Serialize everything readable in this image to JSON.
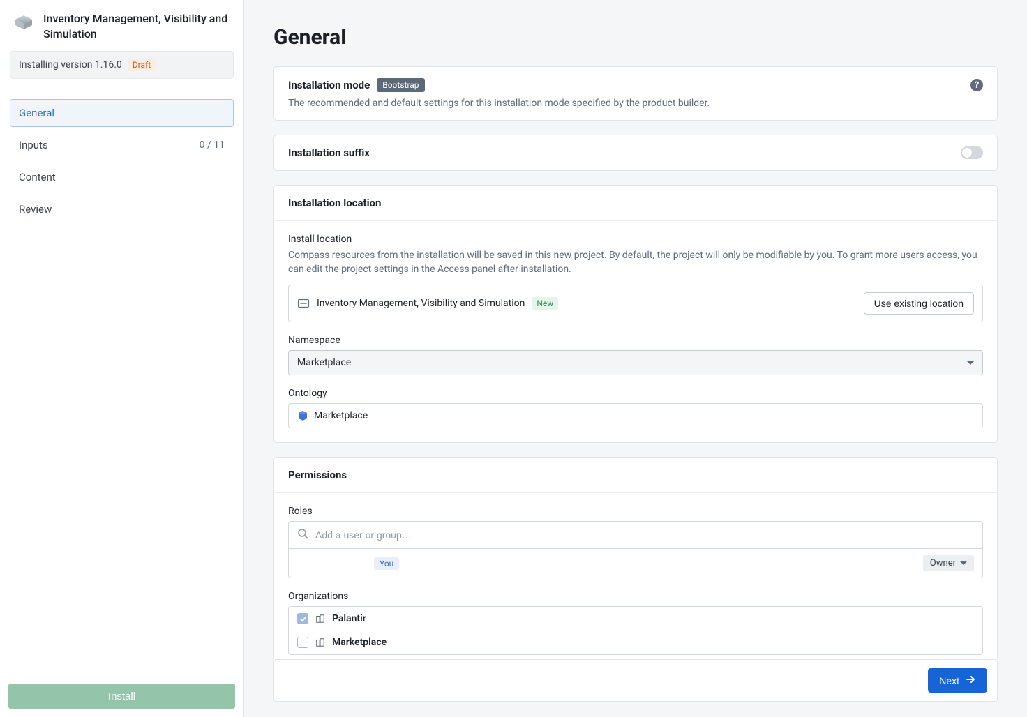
{
  "sidebar": {
    "product_title": "Inventory Management, Visibility and Simulation",
    "version_text": "Installing version 1.16.0",
    "draft_label": "Draft",
    "nav": {
      "general": "General",
      "inputs": "Inputs",
      "inputs_count": "0 / 11",
      "content": "Content",
      "review": "Review"
    },
    "install_button": "Install"
  },
  "page": {
    "title": "General"
  },
  "install_mode": {
    "title": "Installation mode",
    "badge": "Bootstrap",
    "description": "The recommended and default settings for this installation mode specified by the product builder."
  },
  "install_suffix": {
    "title": "Installation suffix"
  },
  "install_location": {
    "title": "Installation location",
    "install_loc_label": "Install location",
    "install_loc_help": "Compass resources from the installation will be saved in this new project. By default, the project will only be modifiable by you. To grant more users access, you can edit the project settings in the Access panel after installation.",
    "project_name": "Inventory Management, Visibility and Simulation",
    "new_badge": "New",
    "use_existing_button": "Use existing location",
    "namespace_label": "Namespace",
    "namespace_value": "Marketplace",
    "ontology_label": "Ontology",
    "ontology_value": "Marketplace"
  },
  "permissions": {
    "title": "Permissions",
    "roles_label": "Roles",
    "search_placeholder": "Add a user or group…",
    "you_label": "You",
    "owner_label": "Owner",
    "orgs_label": "Organizations",
    "orgs": [
      {
        "name": "Palantir",
        "checked": true
      },
      {
        "name": "Marketplace",
        "checked": false
      }
    ]
  },
  "footer": {
    "next": "Next"
  }
}
